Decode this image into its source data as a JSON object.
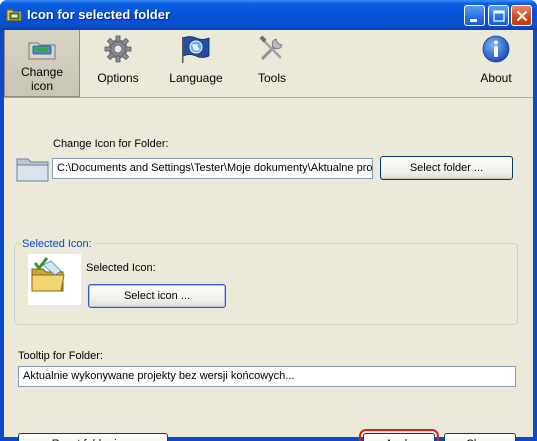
{
  "window": {
    "title": "Icon for selected folder",
    "accent": "#0a49c8"
  },
  "toolbar": {
    "items": [
      {
        "label_line1": "Change",
        "label_line2": "icon",
        "icon": "folder-icon-change",
        "active": true
      },
      {
        "label": "Options",
        "icon": "gear-icon"
      },
      {
        "label": "Language",
        "icon": "flag-globe-icon"
      },
      {
        "label": "Tools",
        "icon": "tools-icon"
      },
      {
        "label": "About",
        "icon": "info-icon"
      }
    ]
  },
  "folder_section": {
    "label": "Change Icon for Folder:",
    "path_value": "C:\\Documents and Settings\\Tester\\Moje dokumenty\\Aktualne pro",
    "select_folder_button": "Select folder ..."
  },
  "icon_section": {
    "group_title": "Selected Icon:",
    "label": "Selected Icon:",
    "select_icon_button": "Select icon ..."
  },
  "tooltip_section": {
    "label": "Tooltip for Folder:",
    "value": "Aktualnie wykonywane projekty bez wersji końcowych..."
  },
  "footer": {
    "reset_button": "Reset folder icon",
    "apply_button": "Apply",
    "close_button": "Close",
    "highlight_color": "#e02020"
  }
}
